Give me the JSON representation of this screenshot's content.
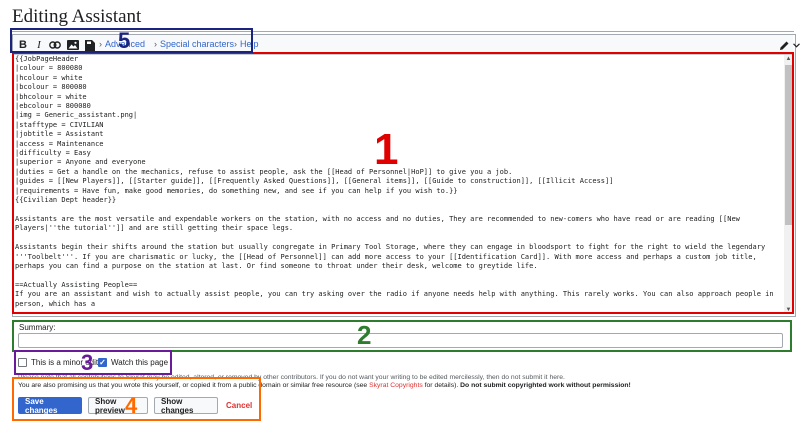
{
  "page": {
    "title": "Editing Assistant"
  },
  "toolbar": {
    "bold_label": "B",
    "italic_label": "I",
    "link_icon": "link-icon",
    "image_icon": "image-icon",
    "template_icon": "template-icon",
    "advanced_label": "Advanced",
    "special_characters_label": "Special characters",
    "help_label": "Help",
    "pen_icon": "pen-icon"
  },
  "editor": {
    "wikitext": "{{JobPageHeader\n|colour = 800080\n|hcolour = white\n|bcolour = 800080\n|bhcolour = white\n|ebcolour = 800080\n|img = Generic_assistant.png|\n|stafftype = CIVILIAN\n|jobtitle = Assistant\n|access = Maintenance\n|difficulty = Easy\n|superior = Anyone and everyone\n|duties = Get a handle on the mechanics, refuse to assist people, ask the [[Head of Personnel|HoP]] to give you a job.\n|guides = [[New Players]], [[Starter guide]], [[Frequently Asked Questions]], [[General items]], [[Guide to construction]], [[Illicit Access]]\n|requirements = Have fun, make good memories, do something new, and see if you can help if you wish to.}}\n{{Civilian Dept header}}\n\nAssistants are the most versatile and expendable workers on the station, with no access and no duties, They are recommended to new-comers who have read or are reading [[New Players|''the tutorial'']] and are still getting their space legs.\n\nAssistants begin their shifts around the station but usually congregate in Primary Tool Storage, where they can engage in bloodsport to fight for the right to wield the legendary '''Toolbelt'''. If you are charismatic or lucky, the [[Head of Personnel]] can add more access to your [[Identification Card]]. With more access and perhaps a custom job title, perhaps you can find a purpose on the station at last. Or find someone to throat under their desk, welcome to greytide life.\n\n==Actually Assisting People==\nIf you are an assistant and wish to actually assist people, you can try asking over the radio if anyone needs help with anything. This rarely works. You can also approach people in person, which has a"
  },
  "summary": {
    "label": "Summary:",
    "value": "",
    "placeholder": ""
  },
  "options": {
    "minor_edit_label": "This is a minor edit",
    "minor_edit_checked": false,
    "watch_label": "Watch this page",
    "watch_checked": true
  },
  "notice": {
    "line1": "Please note that all contributions to Skyrat may be edited, altered, or removed by other contributors. If you do not want your writing to be edited mercilessly, then do not submit it here.",
    "line2_pre": "You are also promising us that you wrote this yourself, or copied it from a public domain or similar free resource (see ",
    "line2_link": "Skyrat Copyrights",
    "line2_mid": " for details). ",
    "line2_bold": "Do not submit copyrighted work without permission!"
  },
  "buttons": {
    "save": "Save changes",
    "preview": "Show preview",
    "changes": "Show changes",
    "cancel": "Cancel"
  },
  "annotations": [
    {
      "label": "1",
      "color": "#e00000"
    },
    {
      "label": "2",
      "color": "#2e7d2e"
    },
    {
      "label": "3",
      "color": "#6a1b9a"
    },
    {
      "label": "4",
      "color": "#ff6a00"
    },
    {
      "label": "5",
      "color": "#1a237e"
    }
  ]
}
